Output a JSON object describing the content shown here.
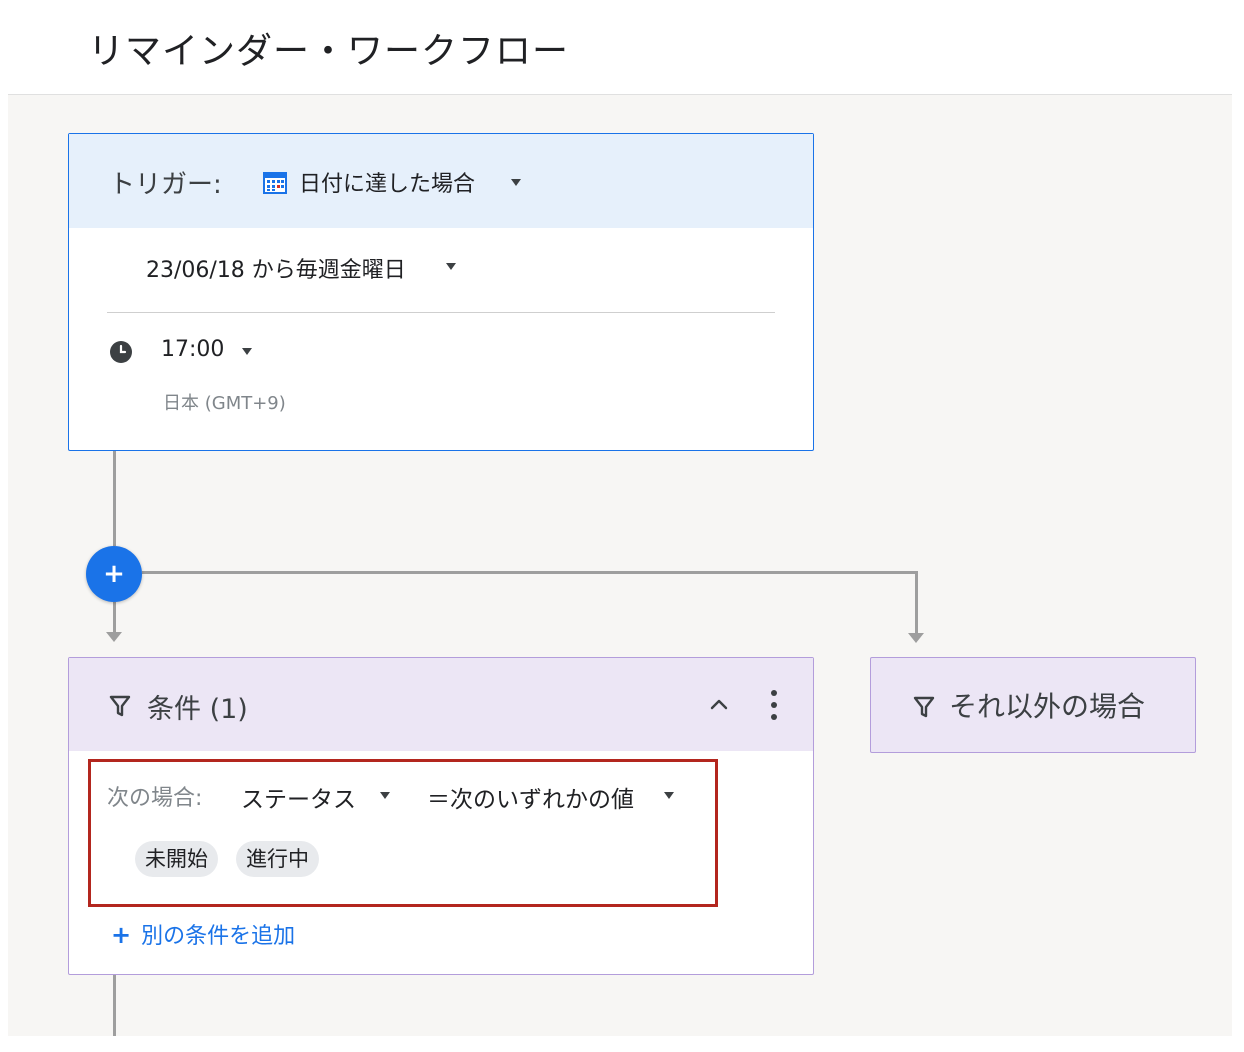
{
  "page": {
    "title": "リマインダー・ワークフロー"
  },
  "trigger": {
    "label": "トリガー:",
    "type": "日付に達した場合",
    "schedule": "23/06/18 から毎週金曜日",
    "time": "17:00",
    "timezone": "日本 (GMT+9)",
    "accent_color": "#1a73e8",
    "header_color": "#e6f0fb"
  },
  "add_button": {
    "label": "+"
  },
  "condition": {
    "title": "条件 (1)",
    "if_label": "次の場合:",
    "field": "ステータス",
    "operator": "＝次のいずれかの値",
    "values": [
      "未開始",
      "進行中"
    ],
    "add_condition_label": "別の条件を追加",
    "border_color": "#b39ddb",
    "header_color": "#ece6f5",
    "highlight_color": "#b3261e"
  },
  "else_branch": {
    "title": "それ以外の場合"
  }
}
